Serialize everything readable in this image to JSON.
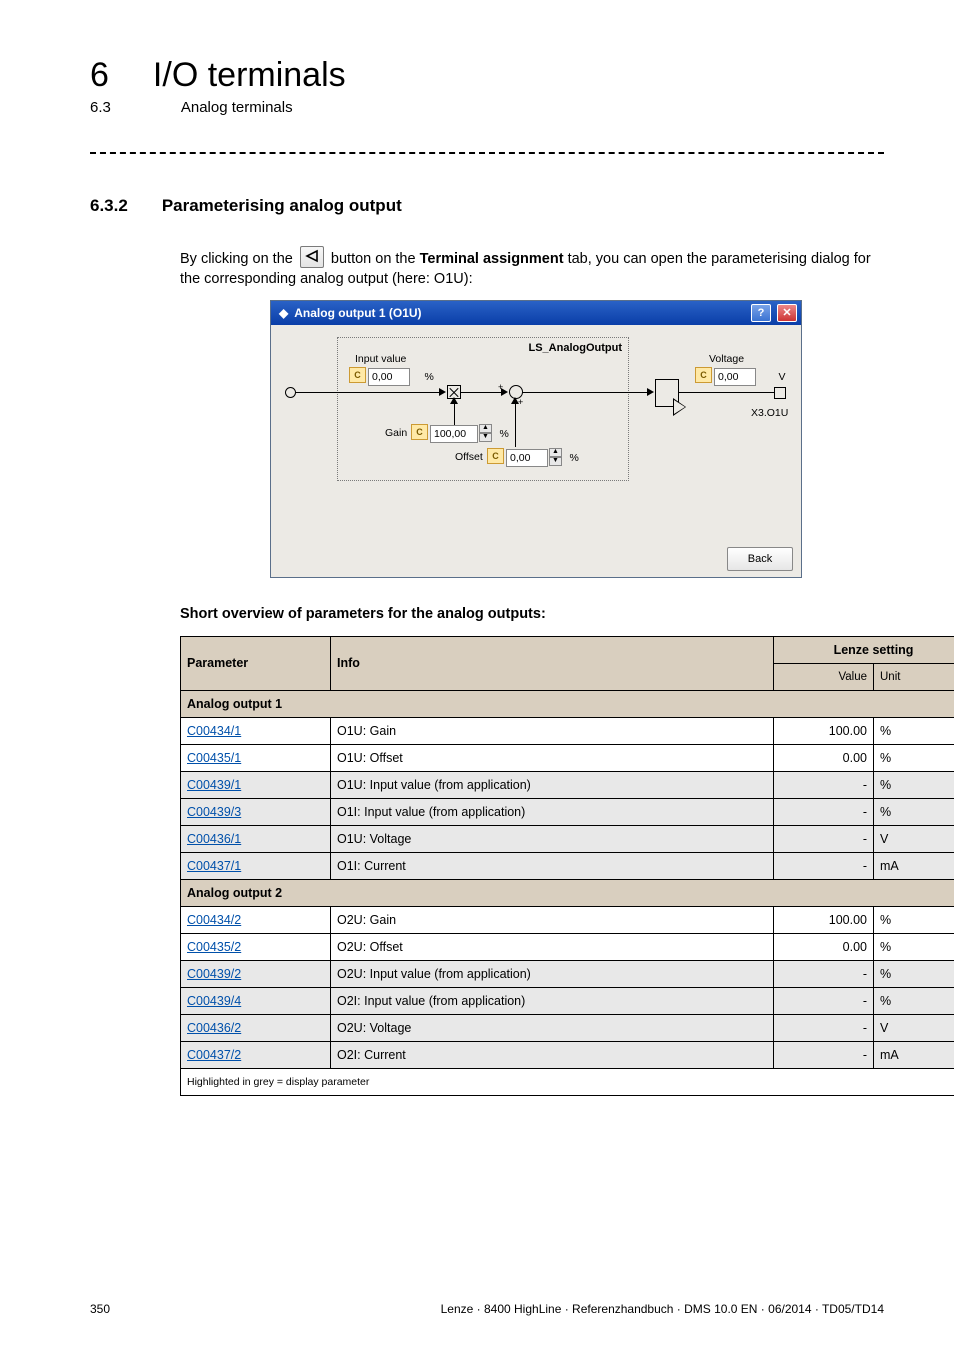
{
  "chapter": {
    "num": "6",
    "title": "I/O terminals"
  },
  "sub": {
    "num": "6.3",
    "title": "Analog terminals"
  },
  "section": {
    "num": "6.3.2",
    "title": "Parameterising analog output"
  },
  "intro": {
    "pre": "By clicking on the ",
    "mid": " button on the ",
    "bold": "Terminal assignment",
    "post": " tab, you can open the parameterising dialog for the corresponding analog output (here: O1U):"
  },
  "dialog": {
    "title": "Analog output 1 (O1U)",
    "ls_label": "LS_AnalogOutput",
    "input_value_lbl": "Input value",
    "input_value": "0,00",
    "pct1": "%",
    "gain_lbl": "Gain",
    "gain_val": "100,00",
    "gain_pct": "%",
    "offset_lbl": "Offset",
    "offset_val": "0,00",
    "offset_pct": "%",
    "voltage_lbl": "Voltage",
    "voltage_val": "0,00",
    "voltage_unit": "V",
    "terminal": "X3.O1U",
    "back": "Back"
  },
  "subhead": "Short overview of parameters for the analog outputs:",
  "thead": {
    "param": "Parameter",
    "info": "Info",
    "lenze": "Lenze setting",
    "value": "Value",
    "unit": "Unit"
  },
  "sections": {
    "a1": "Analog output 1",
    "a2": "Analog output 2"
  },
  "rows": [
    {
      "sec": "a1",
      "grey": false,
      "link": "C00434/1",
      "info": "O1U: Gain",
      "val": "100.00",
      "unit": "%"
    },
    {
      "sec": "a1",
      "grey": false,
      "link": "C00435/1",
      "info": "O1U: Offset",
      "val": "0.00",
      "unit": "%"
    },
    {
      "sec": "a1",
      "grey": true,
      "link": "C00439/1",
      "info": "O1U: Input value (from application)",
      "val": "-",
      "unit": "%"
    },
    {
      "sec": "a1",
      "grey": true,
      "link": "C00439/3",
      "info": "O1I: Input value (from application)",
      "val": "-",
      "unit": "%"
    },
    {
      "sec": "a1",
      "grey": true,
      "link": "C00436/1",
      "info": "O1U: Voltage",
      "val": "-",
      "unit": "V"
    },
    {
      "sec": "a1",
      "grey": true,
      "link": "C00437/1",
      "info": "O1I: Current",
      "val": "-",
      "unit": "mA"
    },
    {
      "sec": "a2",
      "grey": false,
      "link": "C00434/2",
      "info": "O2U: Gain",
      "val": "100.00",
      "unit": "%"
    },
    {
      "sec": "a2",
      "grey": false,
      "link": "C00435/2",
      "info": "O2U: Offset",
      "val": "0.00",
      "unit": "%"
    },
    {
      "sec": "a2",
      "grey": true,
      "link": "C00439/2",
      "info": "O2U: Input value (from application)",
      "val": "-",
      "unit": "%"
    },
    {
      "sec": "a2",
      "grey": true,
      "link": "C00439/4",
      "info": "O2I: Input value (from application)",
      "val": "-",
      "unit": "%"
    },
    {
      "sec": "a2",
      "grey": true,
      "link": "C00436/2",
      "info": "O2U: Voltage",
      "val": "-",
      "unit": "V"
    },
    {
      "sec": "a2",
      "grey": true,
      "link": "C00437/2",
      "info": "O2I: Current",
      "val": "-",
      "unit": "mA"
    }
  ],
  "tfoot": "Highlighted in grey = display parameter",
  "footer": {
    "page": "350",
    "right": "Lenze · 8400 HighLine · Referenzhandbuch · DMS 10.0 EN · 06/2014 · TD05/TD14"
  }
}
